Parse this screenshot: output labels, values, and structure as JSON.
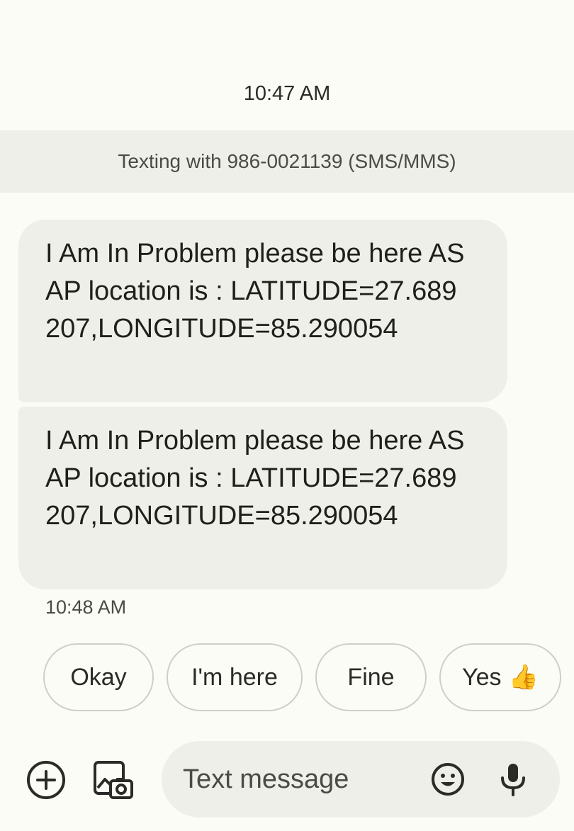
{
  "conversation": {
    "top_timestamp": "10:47 AM",
    "texting_with": "Texting with 986-0021139 (SMS/MMS)",
    "messages": [
      {
        "text": "I Am In Problem please be here ASAP location is : LATITUDE=27.689207,LONGITUDE=85.290054"
      },
      {
        "text": "I Am In Problem please be here ASAP location is : LATITUDE=27.689207,LONGITUDE=85.290054"
      }
    ],
    "message_timestamp": "10:48 AM"
  },
  "smart_replies": [
    {
      "label": "Okay"
    },
    {
      "label": "I'm here"
    },
    {
      "label": "Fine"
    },
    {
      "label": "Yes",
      "emoji": "👍"
    }
  ],
  "composer": {
    "placeholder": "Text message",
    "icons": [
      "add-icon",
      "gallery-icon",
      "emoji-icon",
      "mic-icon"
    ]
  },
  "colors": {
    "background": "#fcfcf6",
    "bubble": "#efefe9",
    "banner": "#efefea",
    "chip_border": "#cfcfca",
    "text": "#1f1f1c"
  }
}
